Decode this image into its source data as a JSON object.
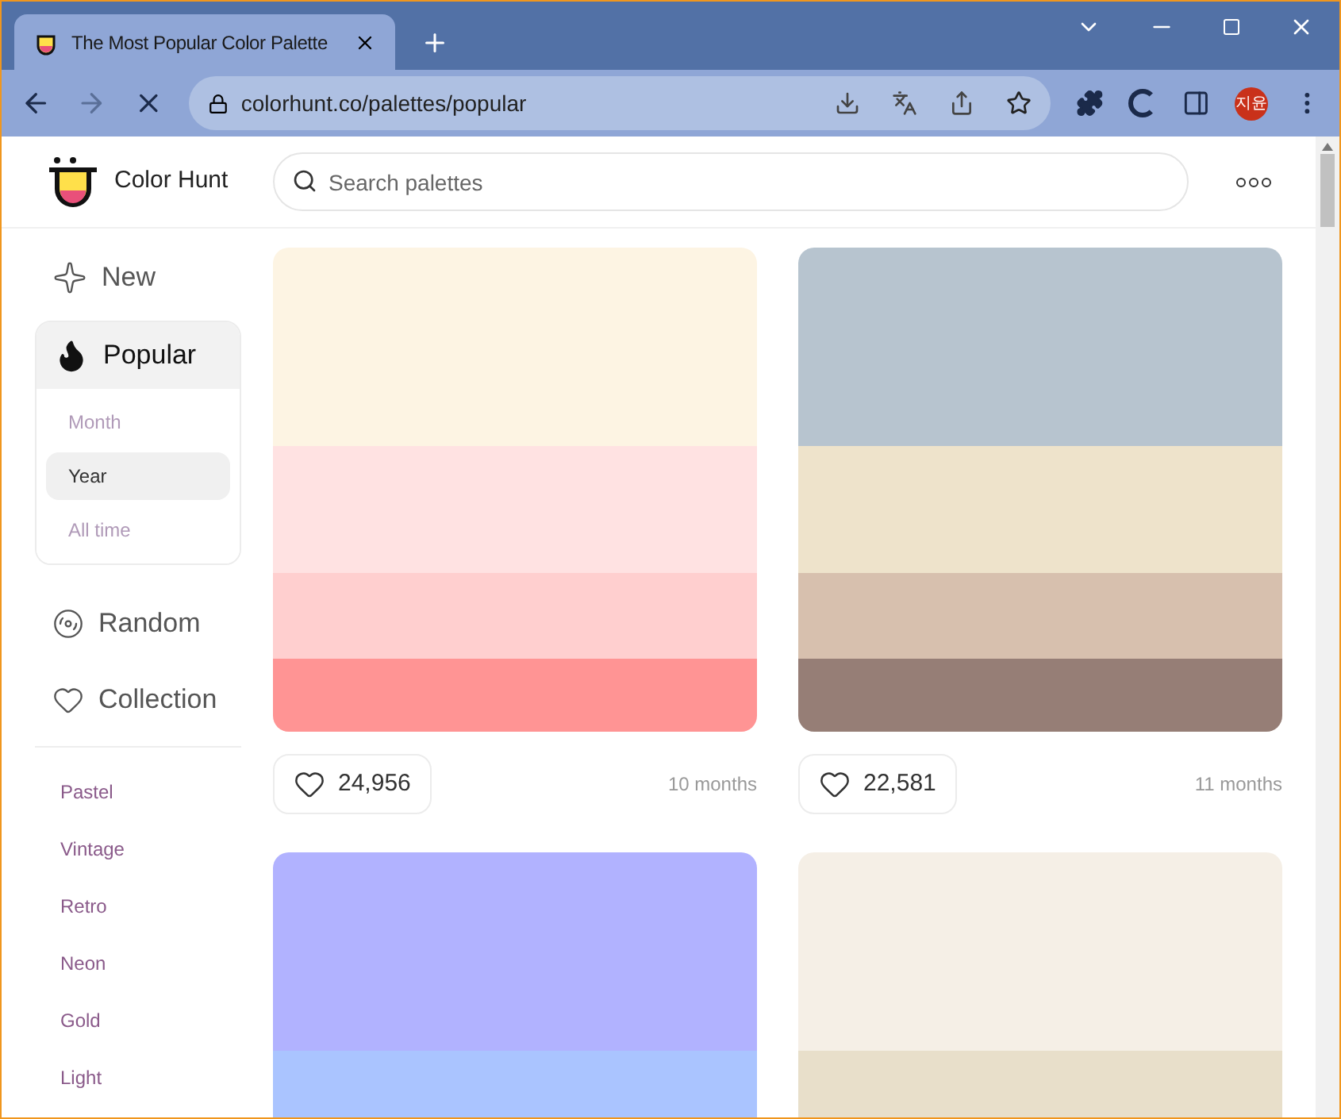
{
  "browser": {
    "tab_title": "The Most Popular Color Palette",
    "url": "colorhunt.co/palettes/popular",
    "profile": "지윤"
  },
  "header": {
    "logo_text": "Color Hunt",
    "search": {
      "placeholder": "Search palettes"
    }
  },
  "sidebar": {
    "nav": [
      {
        "kind": "new",
        "label": "New",
        "selected": false
      },
      {
        "kind": "popular",
        "label": "Popular",
        "selected": true,
        "expanded": true,
        "children": [
          {
            "label": "Month",
            "selected": false
          },
          {
            "label": "Year",
            "selected": true
          },
          {
            "label": "All time",
            "selected": false
          }
        ]
      },
      {
        "kind": "random",
        "label": "Random",
        "selected": false
      },
      {
        "kind": "collection",
        "label": "Collection",
        "selected": false
      }
    ],
    "tags": [
      "Pastel",
      "Vintage",
      "Retro",
      "Neon",
      "Gold",
      "Light"
    ]
  },
  "palettes": [
    {
      "segments": [
        {
          "color": "#fdf4e3"
        },
        {
          "color": "#ffe2e2"
        },
        {
          "color": "#ffcfcf"
        },
        {
          "color": "#ff9494"
        }
      ],
      "likes": "24,956",
      "age": "10 months"
    },
    {
      "segments": [
        {
          "color": "#b7c4cf"
        },
        {
          "color": "#eee3cb"
        },
        {
          "color": "#d7c0ae"
        },
        {
          "color": "#967e76"
        }
      ],
      "likes": "22,581",
      "age": "11 months"
    },
    {
      "segments": [
        {
          "color": "#b1b2ff"
        },
        {
          "color": "#aac4ff"
        }
      ]
    },
    {
      "segments": [
        {
          "color": "#f5efe6"
        },
        {
          "color": "#e8dfca"
        }
      ]
    }
  ]
}
